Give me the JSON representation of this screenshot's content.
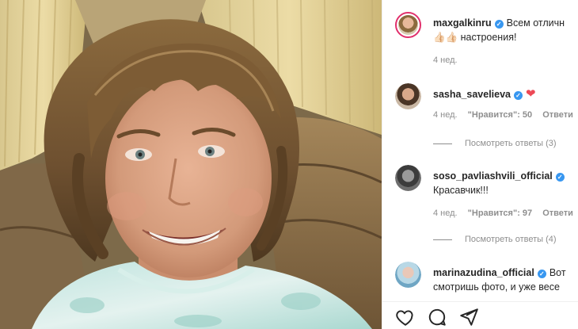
{
  "post": {
    "author": "maxgalkinru",
    "caption_line1": "Всем отличн",
    "caption_line2_emoji": "👍🏻👍🏻",
    "caption_line2": "настроения!",
    "time": "4 нед."
  },
  "comments": [
    {
      "username": "sasha_savelieva",
      "verified": true,
      "text": "",
      "emoji": "❤",
      "time": "4 нед.",
      "likes_label": "\"Нравится\"",
      "likes_count": ": 50",
      "reply_label": "Ответи",
      "view_replies": "Посмотреть ответы (3)"
    },
    {
      "username": "soso_pavliashvili_official",
      "verified": true,
      "text": "Красавчик!!!",
      "time": "4 нед.",
      "likes_label": "\"Нравится\"",
      "likes_count": ": 97",
      "reply_label": "Ответи",
      "view_replies": "Посмотреть ответы (4)"
    },
    {
      "username": "marinazudina_official",
      "verified": true,
      "text": "Вот",
      "text_line2": "смотришь фото, и уже весе"
    }
  ],
  "actions": {
    "like": "heart-icon",
    "comment": "comment-icon",
    "share": "share-icon"
  },
  "colors": {
    "verified": "#3897f0",
    "heart": "#ed4956",
    "muted": "#8e8e8e",
    "text": "#262626"
  }
}
